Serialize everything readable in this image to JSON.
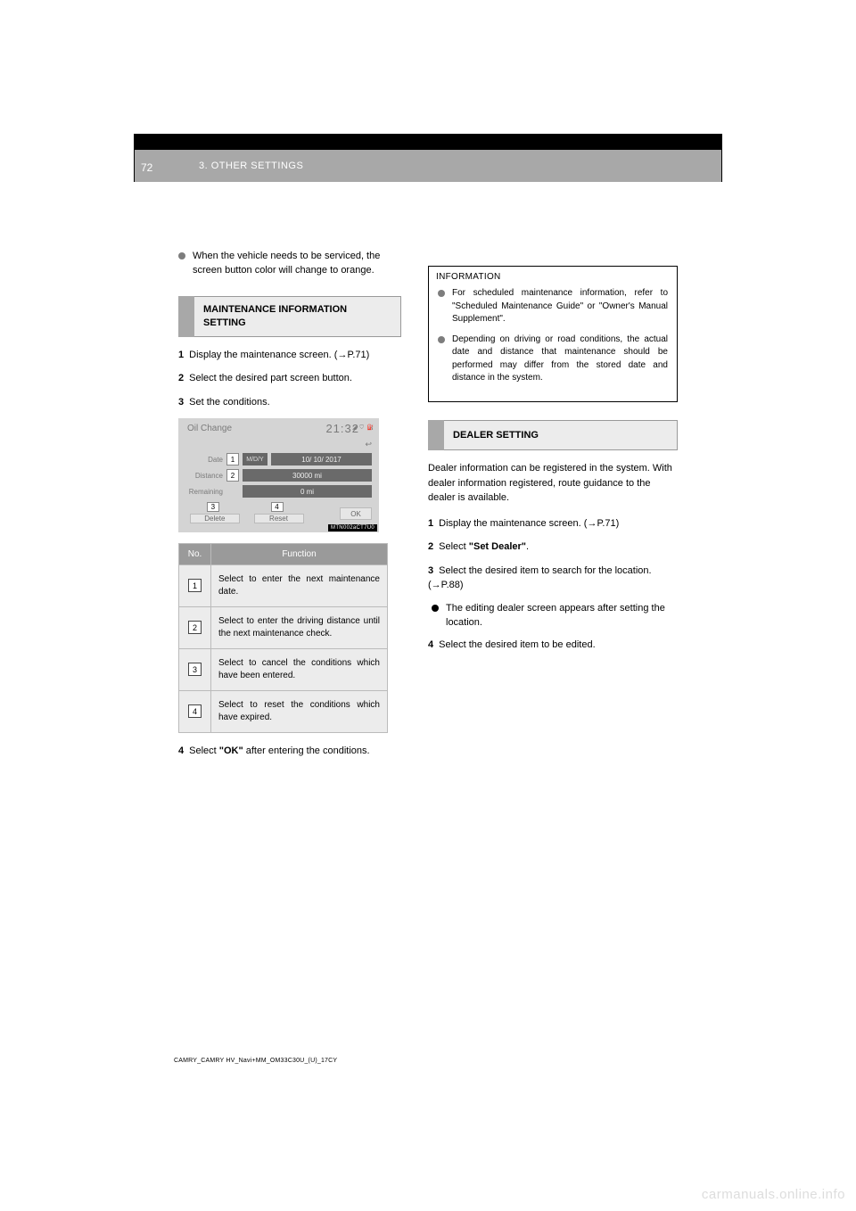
{
  "header": {
    "breadcrumb": "3. OTHER SETTINGS",
    "page_number": "72"
  },
  "left": {
    "bullet1": "When the vehicle needs to be serviced, the screen button color will change to orange.",
    "section_title": "MAINTENANCE INFORMATION SETTING",
    "step1_prefix": "1",
    "step1": "Display the maintenance screen.",
    "step1_ref": "(→P.71)",
    "step2_prefix": "2",
    "step2": "Select the desired part screen button.",
    "step3_prefix": "3",
    "step3": "Set the conditions.",
    "screenshot": {
      "title": "Oil Change",
      "clock": "21:32",
      "status": "◢ ⛉ ⛽",
      "back_icon": "↩",
      "row_date_label": "Date",
      "row_date_chip": "1",
      "row_date_mdy": "M/D/Y",
      "row_date_value": "10/ 10/  2017",
      "row_dist_label": "Distance",
      "row_dist_chip": "2",
      "row_dist_value": "30000 mi",
      "row_remain_label": "Remaining",
      "row_remain_value": "0 mi",
      "btn3_chip": "3",
      "btn3_label": "Delete",
      "btn4_chip": "4",
      "btn4_label": "Reset",
      "ok_label": "OK",
      "code": "MTN002aCT7U0"
    },
    "table": {
      "col_no": "No.",
      "col_func": "Function",
      "rows": [
        {
          "n": "1",
          "desc": "Select to enter the next maintenance date."
        },
        {
          "n": "2",
          "desc": "Select to enter the driving distance until the next maintenance check."
        },
        {
          "n": "3",
          "desc": "Select to cancel the conditions which have been entered."
        },
        {
          "n": "4",
          "desc": "Select to reset the conditions which have expired."
        }
      ]
    },
    "step4_prefix": "4",
    "step4_a": "Select ",
    "step4_quote": "\"OK\"",
    "step4_b": " after entering the conditions."
  },
  "right": {
    "info_title": "INFORMATION",
    "info_bullet1": "For scheduled maintenance information, refer to \"Scheduled Maintenance Guide\" or \"Owner's Manual Supplement\".",
    "info_bullet2": "Depending on driving or road conditions, the actual date and distance that maintenance should be performed may differ from the stored date and distance in the system.",
    "section_title": "DEALER SETTING",
    "intro": "Dealer information can be registered in the system. With dealer information registered, route guidance to the dealer is available.",
    "step1_prefix": "1",
    "step1": "Display the maintenance screen.",
    "step1_ref": "(→P.71)",
    "step2_prefix": "2",
    "step2_a": "Select ",
    "step2_quote": "\"Set Dealer\"",
    "step2_b": ".",
    "step3_prefix": "3",
    "step3_a": "Select the desired item to search for the location. ",
    "step3_ref": "(→P.88)",
    "step3_note": "The editing dealer screen appears after setting the location.",
    "step4_prefix": "4",
    "step4": "Select the desired item to be edited."
  },
  "footer": "CAMRY_CAMRY HV_Navi+MM_OM33C30U_(U)_17CY",
  "watermark": "carmanuals.online.info"
}
